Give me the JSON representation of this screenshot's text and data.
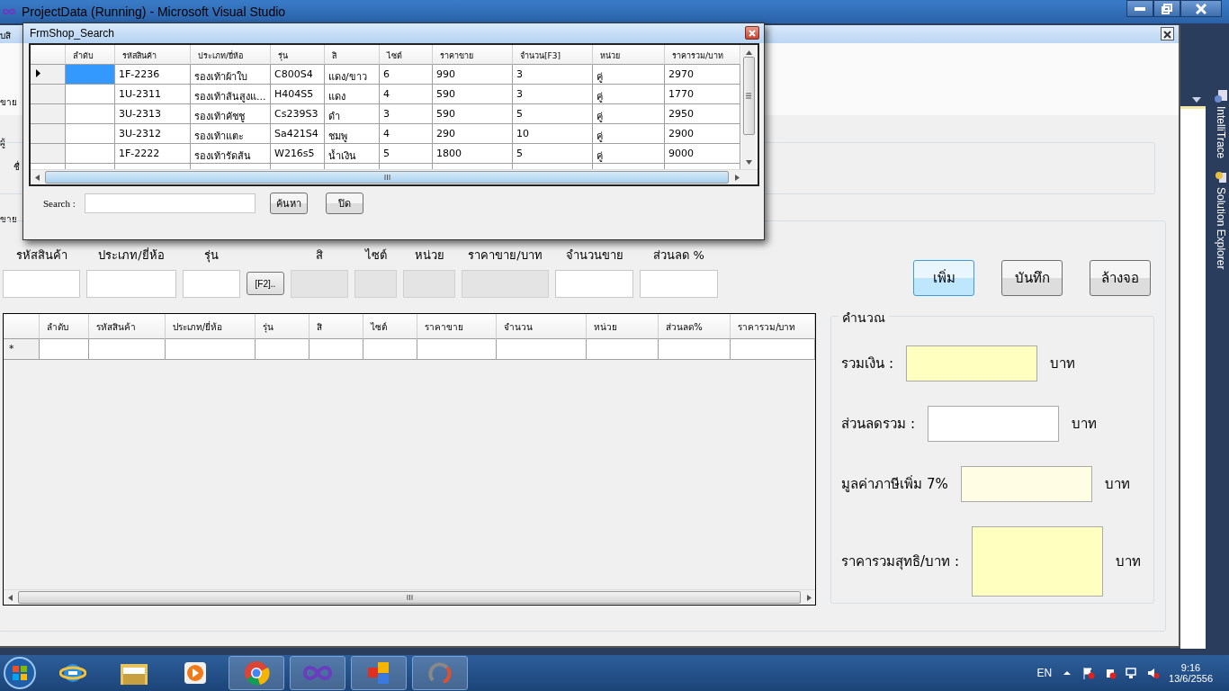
{
  "window": {
    "title": "ProjectData (Running) - Microsoft Visual Studio"
  },
  "main_form": {
    "edge_texts": [
      "บสิ",
      "ขาย",
      "ผู้",
      "ชื่",
      "ขาย"
    ],
    "entry_fields": [
      {
        "kind": "field",
        "label": "รหัสสินค้า",
        "disabled": false
      },
      {
        "kind": "field",
        "label": "ประเภท/ยี่ห้อ",
        "disabled": false
      },
      {
        "kind": "field",
        "label": "รุ่น",
        "disabled": false
      },
      {
        "kind": "button",
        "label": "[F2].."
      },
      {
        "kind": "field",
        "label": "สิ",
        "disabled": true
      },
      {
        "kind": "field",
        "label": "ไซต์",
        "disabled": true
      },
      {
        "kind": "field",
        "label": "หน่วย",
        "disabled": true
      },
      {
        "kind": "field",
        "label": "ราคาขาย/บาท",
        "disabled": true
      },
      {
        "kind": "field",
        "label": "จำนวนขาย",
        "disabled": false
      },
      {
        "kind": "field",
        "label": "ส่วนลด %",
        "disabled": false
      }
    ],
    "buttons": [
      {
        "label": "เพิ่ม",
        "focused": true
      },
      {
        "label": "บันทึก",
        "focused": false
      },
      {
        "label": "ล้างจอ",
        "focused": false
      }
    ],
    "grid": {
      "columns": [
        "ลำดับ",
        "รหัสสินค้า",
        "ประเภท/ยี่ห้อ",
        "รุ่น",
        "สิ",
        "ไซต์",
        "ราคาขาย",
        "จำนวน",
        "หน่วย",
        "ส่วนลด%",
        "ราคารวม/บาท"
      ],
      "new_row_marker": "*"
    },
    "calculation": {
      "title": "คำนวณ",
      "rows": [
        {
          "label": "รวมเงิน :",
          "unit": "บาท",
          "color": "#ffffc0",
          "kind": "normal"
        },
        {
          "label": "ส่วนลดรวม :",
          "unit": "บาท",
          "color": "#ffffff",
          "kind": "normal"
        },
        {
          "label": "มูลค่าภาษีเพิ่ม 7%",
          "unit": "บาท",
          "color": "#fffde4",
          "kind": "normal"
        },
        {
          "label": "ราคารวมสุทธิ/บาท :",
          "unit": "บาท",
          "color": "#ffffc0",
          "kind": "tall"
        }
      ]
    }
  },
  "dialog": {
    "title": "FrmShop_Search",
    "columns": [
      "ลำดับ",
      "รหัสสินค้า",
      "ประเภท/ยี่ห้อ",
      "รุ่น",
      "สิ",
      "ไซต์",
      "ราคาขาย",
      "จำนวน[F3]",
      "หน่วย",
      "ราคารวม/บาท"
    ],
    "rows": [
      {
        "selected": true,
        "cells": [
          "",
          "1F-2236",
          "รองเท้าผ้าใบ",
          "C800S4",
          "แดง/ขาว",
          "6",
          "990",
          "3",
          "คู่",
          "2970"
        ]
      },
      {
        "selected": false,
        "cells": [
          "",
          "1U-2311",
          "รองเท้าส้นสูงแ...",
          "H404S5",
          "แดง",
          "4",
          "590",
          "3",
          "คู่",
          "1770"
        ]
      },
      {
        "selected": false,
        "cells": [
          "",
          "3U-2313",
          "รองเท้าคัชชู",
          "Cs239S3",
          "ดำ",
          "3",
          "590",
          "5",
          "คู่",
          "2950"
        ]
      },
      {
        "selected": false,
        "cells": [
          "",
          "3U-2312",
          "รองเท้าแตะ",
          "Sa421S4",
          "ชมพู",
          "4",
          "290",
          "10",
          "คู่",
          "2900"
        ]
      },
      {
        "selected": false,
        "cells": [
          "",
          "1F-2222",
          "รองเท้ารัดส้น",
          "W216s5",
          "น้ำเงิน",
          "5",
          "1800",
          "5",
          "คู่",
          "9000"
        ]
      }
    ],
    "search_label": "Search :",
    "buttons": [
      "ค้นหา",
      "ปิด"
    ]
  },
  "side_panel": {
    "tabs": [
      "IntelliTrace",
      "Solution Explorer"
    ]
  },
  "taskbar": {
    "apps": [
      {
        "kind": "browser",
        "running": false
      },
      {
        "kind": "folder",
        "running": false
      },
      {
        "kind": "media",
        "running": false
      },
      {
        "kind": "chrome",
        "running": true
      },
      {
        "kind": "studio",
        "running": true
      },
      {
        "kind": "app",
        "running": true
      },
      {
        "kind": "sync",
        "running": true
      }
    ],
    "language": "EN",
    "time": "9:16",
    "date": "13/6/2556"
  }
}
